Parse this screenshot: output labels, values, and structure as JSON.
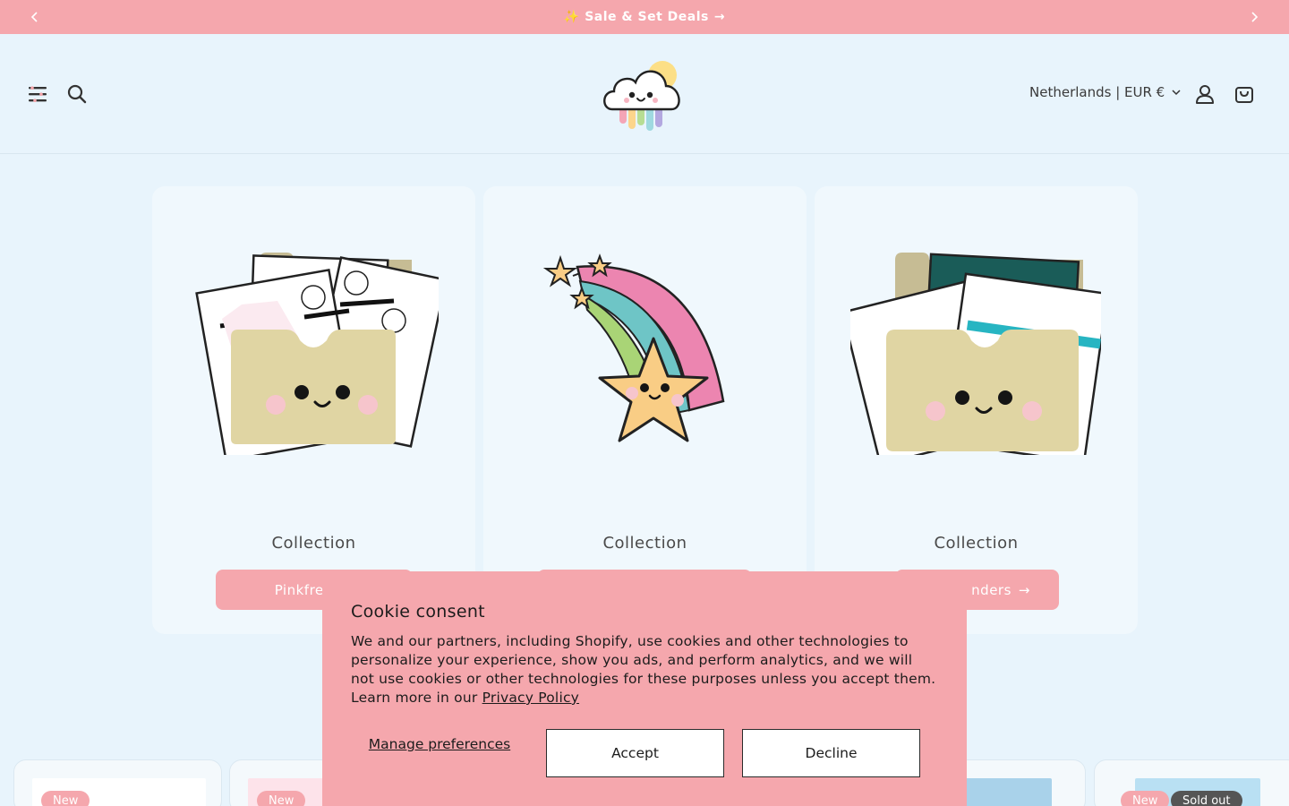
{
  "announcement": {
    "text": "✨ Sale & Set Deals",
    "arrow": "→",
    "prev_icon": "chevron-left-icon",
    "next_icon": "chevron-right-icon",
    "background": "#f5a7ad"
  },
  "header": {
    "menu_icon": "menu-icon",
    "search_icon": "search-icon",
    "logo_icon": "rainbow-cloud-logo",
    "country_selector": "Netherlands | EUR €",
    "account_icon": "account-icon",
    "cart_icon": "cart-icon"
  },
  "collections": [
    {
      "label": "Collection",
      "button": "Pinkfresh S",
      "art": "folder-pinkfresh-icon"
    },
    {
      "label": "Collection",
      "button": "",
      "art": "shooting-star-rainbow-icon"
    },
    {
      "label": "Collection",
      "button": "nders",
      "art": "folder-spellbinders-icon"
    }
  ],
  "collection_arrow": "→",
  "products": {
    "badges": [
      "New",
      "New",
      "New",
      "Sold out"
    ]
  },
  "cookie": {
    "title": "Cookie consent",
    "body": "We and our partners, including Shopify, use cookies and other technologies to personalize your experience, show you ads, and perform analytics, and we will not use cookies or other technologies for these purposes unless you accept them. Learn more in our",
    "link": "Privacy Policy",
    "manage": "Manage preferences",
    "accept": "Accept",
    "decline": "Decline"
  },
  "colors": {
    "accent": "#f5a7ad",
    "page_bg": "#e8f4fc",
    "card_bg": "#f0f8fd"
  }
}
